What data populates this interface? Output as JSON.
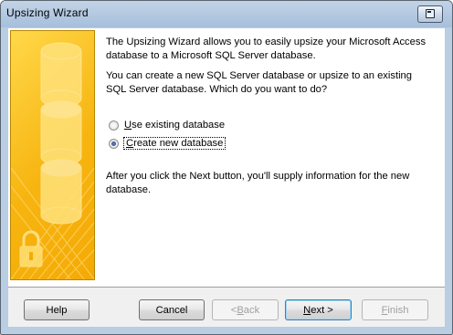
{
  "window": {
    "title": "Upsizing  Wizard"
  },
  "intro_text": "The Upsizing Wizard allows you to easily upsize your Microsoft Access database to a Microsoft SQL Server database.",
  "question_text": "You can create a new SQL Server database or upsize to an existing SQL Server database. Which do you want to do?",
  "options": [
    {
      "label_mnemonic": "U",
      "label_rest": "se existing database",
      "checked": false
    },
    {
      "label_mnemonic": "C",
      "label_rest": "reate new database",
      "checked": true
    }
  ],
  "after_text": "After you click the Next button, you'll supply information for the new database.",
  "buttons": {
    "help": "Help",
    "cancel": "Cancel",
    "back": "< Back",
    "back_mnemonic": "B",
    "next": "Next >",
    "next_mnemonic": "N",
    "finish": "Finish",
    "finish_mnemonic": "F"
  },
  "icons": {
    "system_menu": "system-menu-icon",
    "art": "database-lock-illustration"
  },
  "colors": {
    "accent_yellow": "#f7b40f",
    "title_bar": "#b9cde3",
    "default_button_border": "#3c7fb1"
  }
}
